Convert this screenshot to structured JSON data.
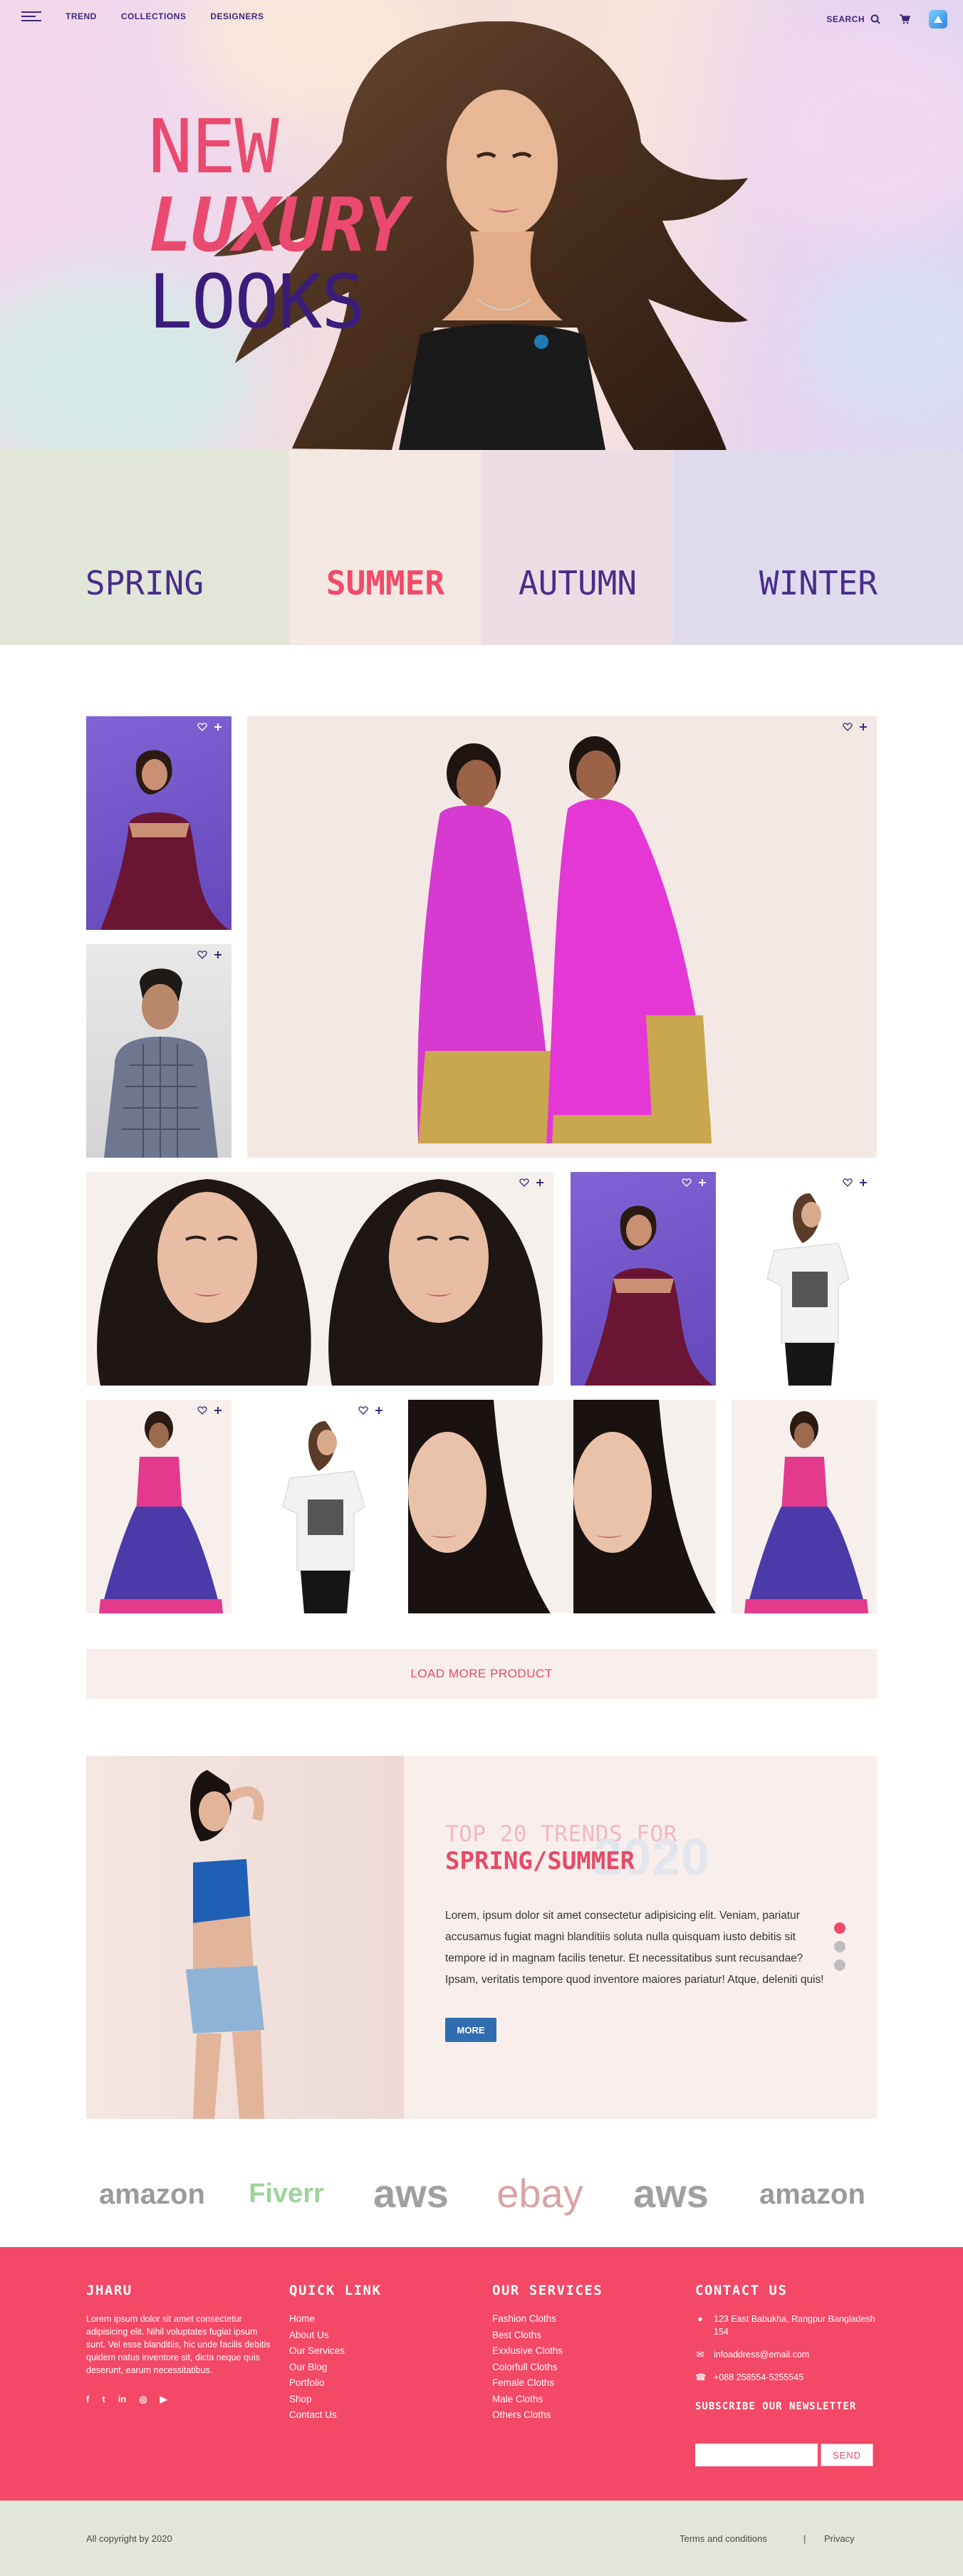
{
  "nav": {
    "links": [
      "TREND",
      "COLLECTIONS",
      "DESIGNERS"
    ],
    "search_label": "SEARCH"
  },
  "hero": {
    "line1": "NEW",
    "line2": "LUXURY",
    "line3": "LOOKS"
  },
  "seasons": [
    {
      "label": "SPRING",
      "bg": "#e2e6d9"
    },
    {
      "label": "SUMMER",
      "bg": "#f4e8e2"
    },
    {
      "label": "AUTUMN",
      "bg": "#ecdde4"
    },
    {
      "label": "WINTER",
      "bg": "#dedbed"
    }
  ],
  "products": {
    "load_more": "LOAD MORE PRODUCT"
  },
  "trends": {
    "title_line1": "TOP 20 TRENDS FOR",
    "title_line2": "SPRING/SUMMER",
    "year": "2020",
    "text": "Lorem, ipsum dolor sit amet consectetur adipisicing elit. Veniam, pariatur accusamus fugiat magni blanditiis soluta nulla quisquam iusto debitis sit tempore id in magnam facilis tenetur. Et necessitatibus sunt recusandae? Ipsam, veritatis tempore quod inventore maiores pariatur! Atque, deleniti quis!",
    "button": "MORE"
  },
  "brands": [
    "amazon",
    "Fiverr",
    "aws",
    "ebay",
    "aws",
    "amazon"
  ],
  "footer": {
    "about": {
      "title": "JHARU",
      "text": "Lorem ipsum dolor sit amet consectetur adipisicing elit. Nihil voluptates fugiat ipsum sunt. Vel esse blanditiis, hic unde facilis debitis quidem natus inventore sit, dicta neque quis deserunt, earum necessitatibus."
    },
    "quick_link": {
      "title": "QUICK LINK",
      "items": [
        "Home",
        "About Us",
        "Our Services",
        "Our Blog",
        "Portfolio",
        "Shop",
        "Contact Us"
      ]
    },
    "services": {
      "title": "OUR SERVICES",
      "items": [
        "Fashion Cloths",
        "Best Cloths",
        "Exxlusive Cloths",
        "Colorfull Cloths",
        "Female Cloths",
        "Male Cloths",
        "Others Cloths"
      ]
    },
    "contact": {
      "title": "CONTACT US",
      "address": "123 East Babukha, Rangpur Bangladesh 154",
      "email": "infoaddress@email.com",
      "phone": "+088 258554-5255545"
    },
    "newsletter": {
      "title": "SUBSCRIBE OUR NEWSLETTER",
      "button": "SEND"
    }
  },
  "bottom": {
    "copyright": "All copyright by 2020",
    "links": [
      "Terms and conditions",
      "|",
      "Privacy"
    ]
  },
  "colors": {
    "accent": "#e64a66",
    "footer_bg": "#f34866",
    "nav_text": "#3b2a7a",
    "button_blue": "#2f6db0"
  }
}
